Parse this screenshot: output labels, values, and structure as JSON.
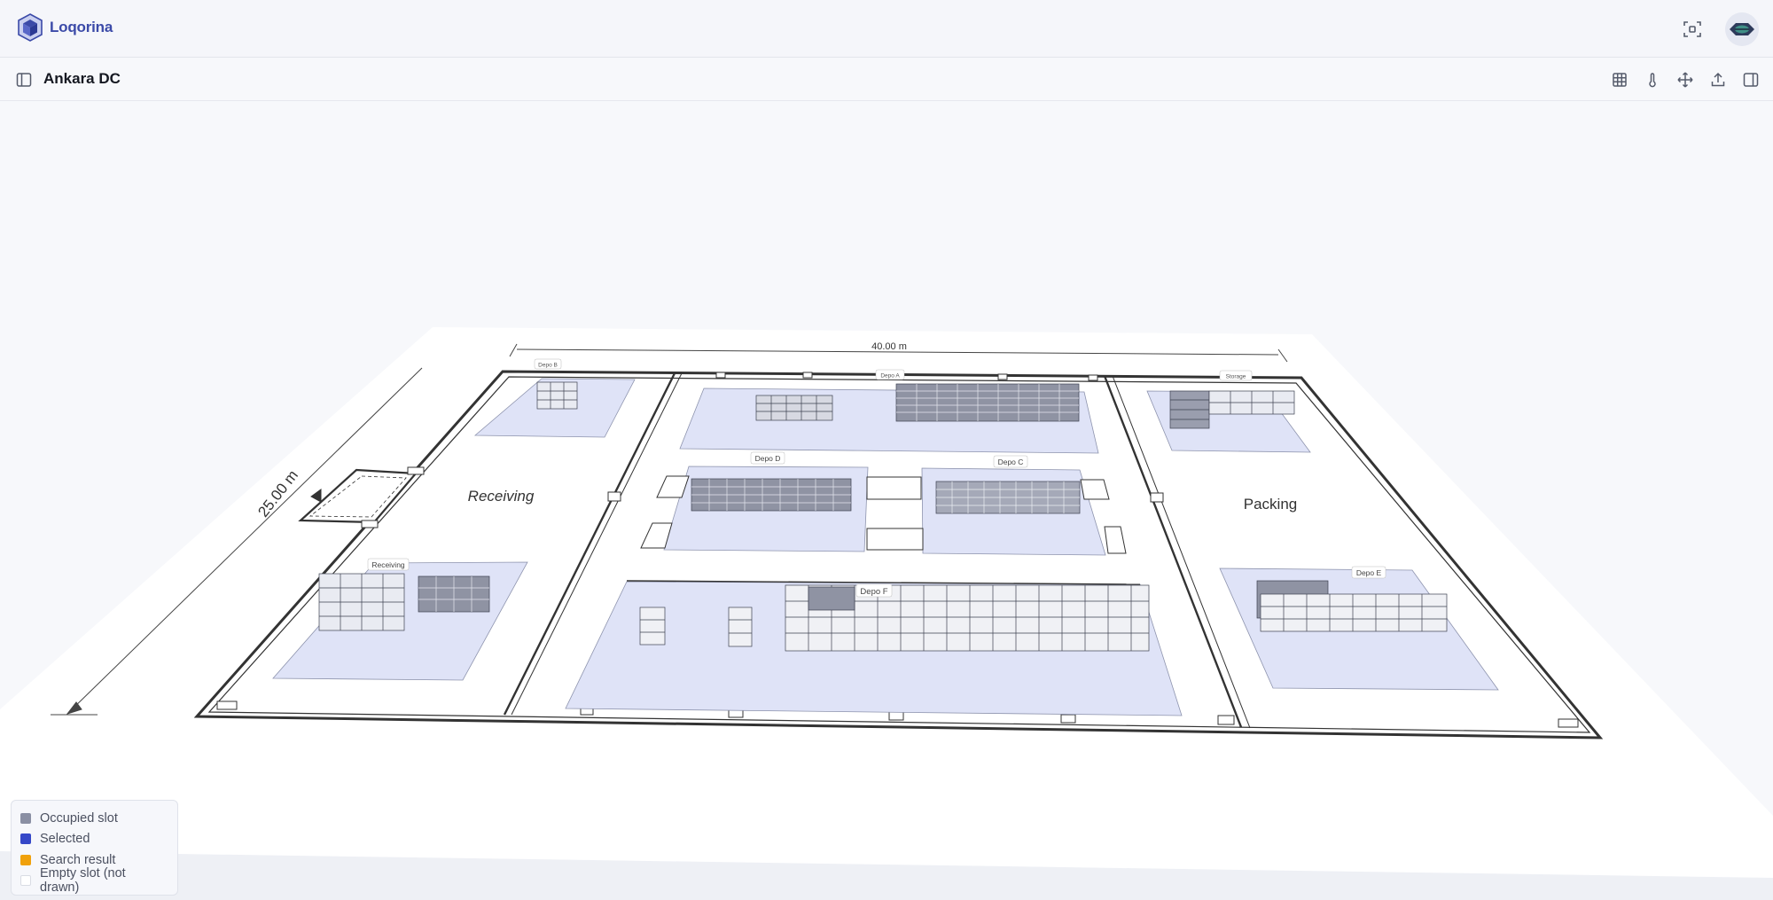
{
  "app": {
    "name": "Loqorina"
  },
  "page": {
    "title": "Ankara DC"
  },
  "floor": {
    "width_label": "40.00 m",
    "depth_label": "25.00 m",
    "rooms": [
      {
        "id": "receiving",
        "label": "Receiving"
      },
      {
        "id": "packing",
        "label": "Packing"
      }
    ],
    "zones": [
      {
        "id": "depo-b",
        "label": "Depo B"
      },
      {
        "id": "depo-a",
        "label": "Depo A"
      },
      {
        "id": "storage",
        "label": "Storage"
      },
      {
        "id": "depo-d",
        "label": "Depo D"
      },
      {
        "id": "depo-c",
        "label": "Depo C"
      },
      {
        "id": "receiving-zone",
        "label": "Receiving"
      },
      {
        "id": "depo-f",
        "label": "Depo F"
      },
      {
        "id": "depo-e",
        "label": "Depo E"
      }
    ]
  },
  "legend": {
    "items": [
      {
        "label": "Occupied slot",
        "color": "#8a8fa3"
      },
      {
        "label": "Selected",
        "color": "#3547c8"
      },
      {
        "label": "Search result",
        "color": "#f0a10c"
      },
      {
        "label": "Empty slot (not drawn)",
        "color": "#ffffff"
      }
    ]
  },
  "colors": {
    "accent": "#3b4aa8",
    "zone_fill": "#dfe3f7",
    "floor_fill": "#ffffff"
  },
  "icons": {
    "top": [
      "scan-frame-icon",
      "user-avatar-icon"
    ],
    "toolbar": [
      "grid-icon",
      "temperature-icon",
      "move-icon",
      "export-icon",
      "panel-right-icon"
    ]
  }
}
